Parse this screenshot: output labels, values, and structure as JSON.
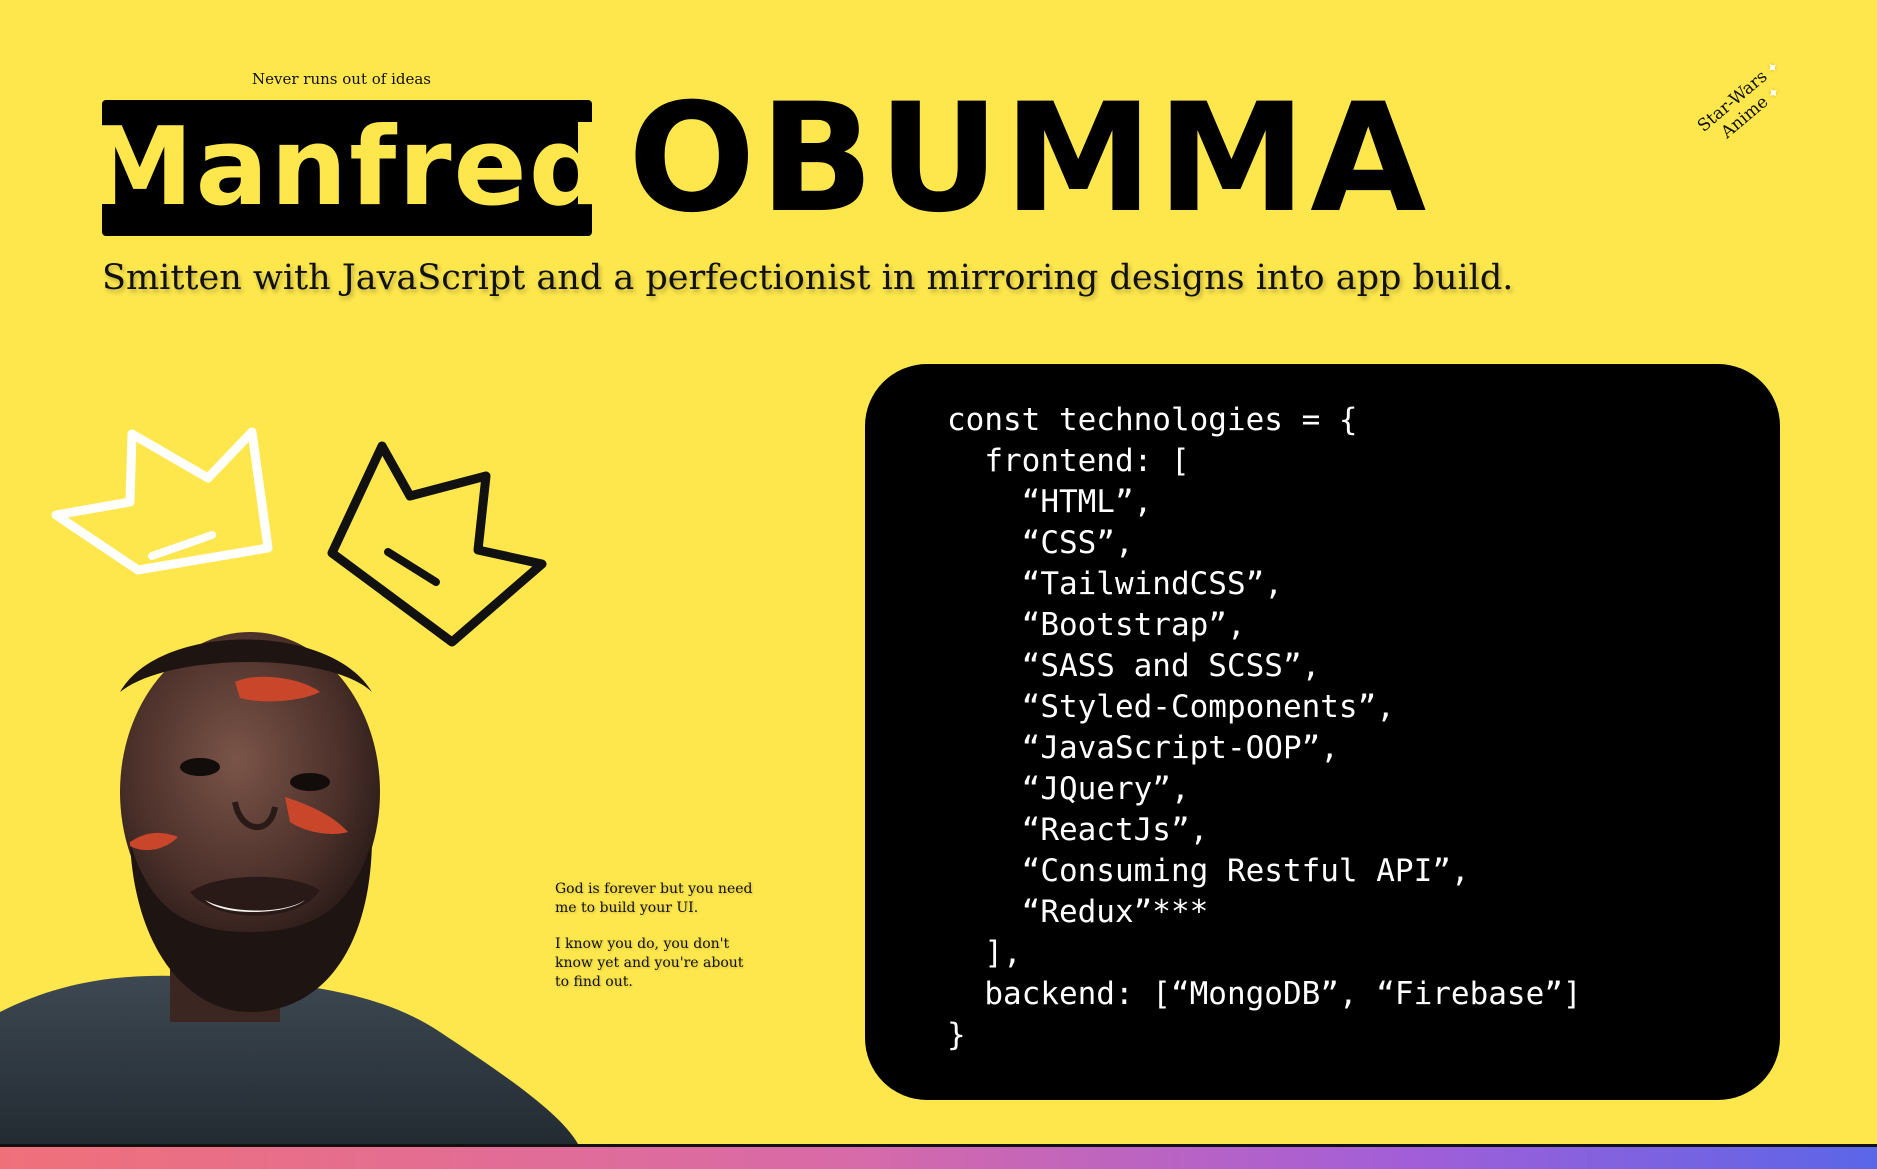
{
  "header": {
    "tagline": "Never runs out of ideas",
    "first_name": "Manfred",
    "last_name": "OBUMMA",
    "subtitle": "Smitten with JavaScript and a perfectionist in mirroring designs into app build."
  },
  "hobbies": {
    "line1": "Star-Wars",
    "line2": "Anime",
    "sparkle_icon": "sparkle-icon"
  },
  "quote": {
    "para1": "God is forever but you need me to build your UI.",
    "para2": "I know you do, you don't know yet and you're about to find out."
  },
  "code": {
    "lines": [
      "const technologies = {",
      "  frontend: [",
      "    “HTML”,",
      "    “CSS”,",
      "    “TailwindCSS”,",
      "    “Bootstrap”,",
      "    “SASS and SCSS”,",
      "    “Styled-Components”,",
      "    “JavaScript-OOP”,",
      "    “JQuery”,",
      "    “ReactJs”,",
      "    “Consuming Restful API”,",
      "    “Redux”***",
      "  ],",
      "  backend: [“MongoDB”, “Firebase”]",
      "}"
    ]
  },
  "colors": {
    "background": "#fde74c",
    "name_box": "#000000",
    "code_card": "#000000",
    "code_text": "#ffffff"
  },
  "icons": [
    "crown-outline-white-icon",
    "crown-outline-black-icon",
    "sparkle-icon"
  ]
}
